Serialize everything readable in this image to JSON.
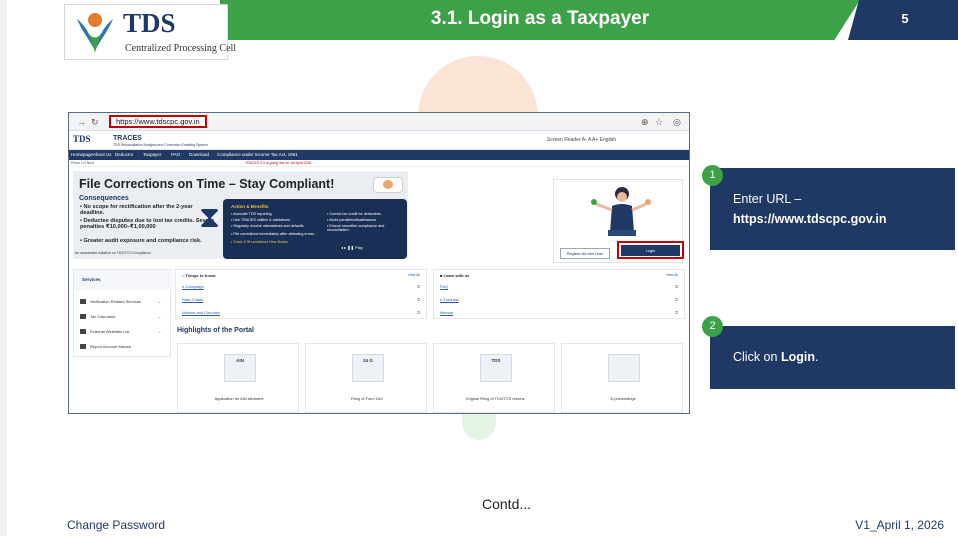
{
  "slide": {
    "title": "3.1. Login as a Taxpayer",
    "number": "5",
    "contd": "Contd...",
    "footer_left": "Change Password",
    "footer_right": "V1_April 1, 2026"
  },
  "logo": {
    "name": "TDS",
    "subtitle": "Centralized Processing Cell"
  },
  "browser": {
    "url": "https://www.tdscpc.gov.in",
    "icons": [
      "back-arrow-icon",
      "reload-icon",
      "zoom-icon",
      "star-icon",
      "profile-icon"
    ]
  },
  "site": {
    "logo": "TDS",
    "name": "TRACES",
    "name_sub": "TDS Reconciliation Analysis and Correction Enabling System",
    "tools": "Screen Reader   A-   A   A+      English",
    "nav": [
      "Homepage",
      "About Us",
      "Deductor",
      "Taxpayer",
      "PAO",
      "Download",
      "Compliance under Income Tax Act, 1961"
    ],
    "ticker_label": "Press   1/4   Next",
    "ticker_text": "TRACES 2.0 is going live on 1st April 2026"
  },
  "banner": {
    "title": "File Corrections on Time – Stay Compliant!",
    "consequences_heading": "Consequences",
    "points": [
      "• No scope for rectification after the 2-year deadline.",
      "• Deductee disputes due to lost tax credits. Severe penalties ₹10,000–₹1,00,000",
      "• Greater audit exposure and compliance risk."
    ],
    "awareness": "An awareness initiative on TDS/TCS Compliance",
    "card_heading": "Action & Benefits",
    "card_left": [
      "• Accurate TDS reporting.",
      "• Use TRACES utilities & validations.",
      "• Regularly resolve mismatches and defaults.",
      "• File corrections immediately after detecting errors.",
      "• Track & fill unclaimed New Books"
    ],
    "card_right": [
      "• Correct tax credit for deductees.",
      "• Avoid penalties/disallowance.",
      "• Ensure smoother compliance and reconciliation."
    ],
    "card_buttons": "◂   ▸   ❚❚ Play"
  },
  "login_card": {
    "register": "Register As new User",
    "login": "Login"
  },
  "services": {
    "heading": "Services",
    "items": [
      "Verification Related Services",
      "Tax Calculator",
      "External Websites List",
      "Report Account Misuse"
    ]
  },
  "things_to_know": {
    "heading": "Things to Know",
    "view_all": "View All",
    "links": [
      "e-Campaign",
      "Rate Charts",
      "Notices and Circulars"
    ]
  },
  "learn_with_us": {
    "heading": "Learn with us",
    "view_all": "View All",
    "links": [
      "FAQ",
      "e-Tutorials",
      "Manual"
    ]
  },
  "highlights": {
    "title": "Highlights of the Portal",
    "cards": [
      {
        "icon": "AIN",
        "caption": "Application for AIN allotment"
      },
      {
        "icon": "24 G",
        "caption": "Filing of Form 24G"
      },
      {
        "icon": "TDS",
        "caption": "Original Filing of TDS/TCS returns"
      },
      {
        "icon": "",
        "caption": "E-proceedings"
      }
    ]
  },
  "steps": [
    {
      "number": "1",
      "line1": "Enter URL –",
      "line2": "https://www.tdscpc.gov.in"
    },
    {
      "number": "2",
      "prefix": "Click on ",
      "bold": "Login",
      "suffix": "."
    }
  ],
  "colors": {
    "green": "#3da148",
    "navy": "#1f3864",
    "highlight_red": "#c00000"
  }
}
